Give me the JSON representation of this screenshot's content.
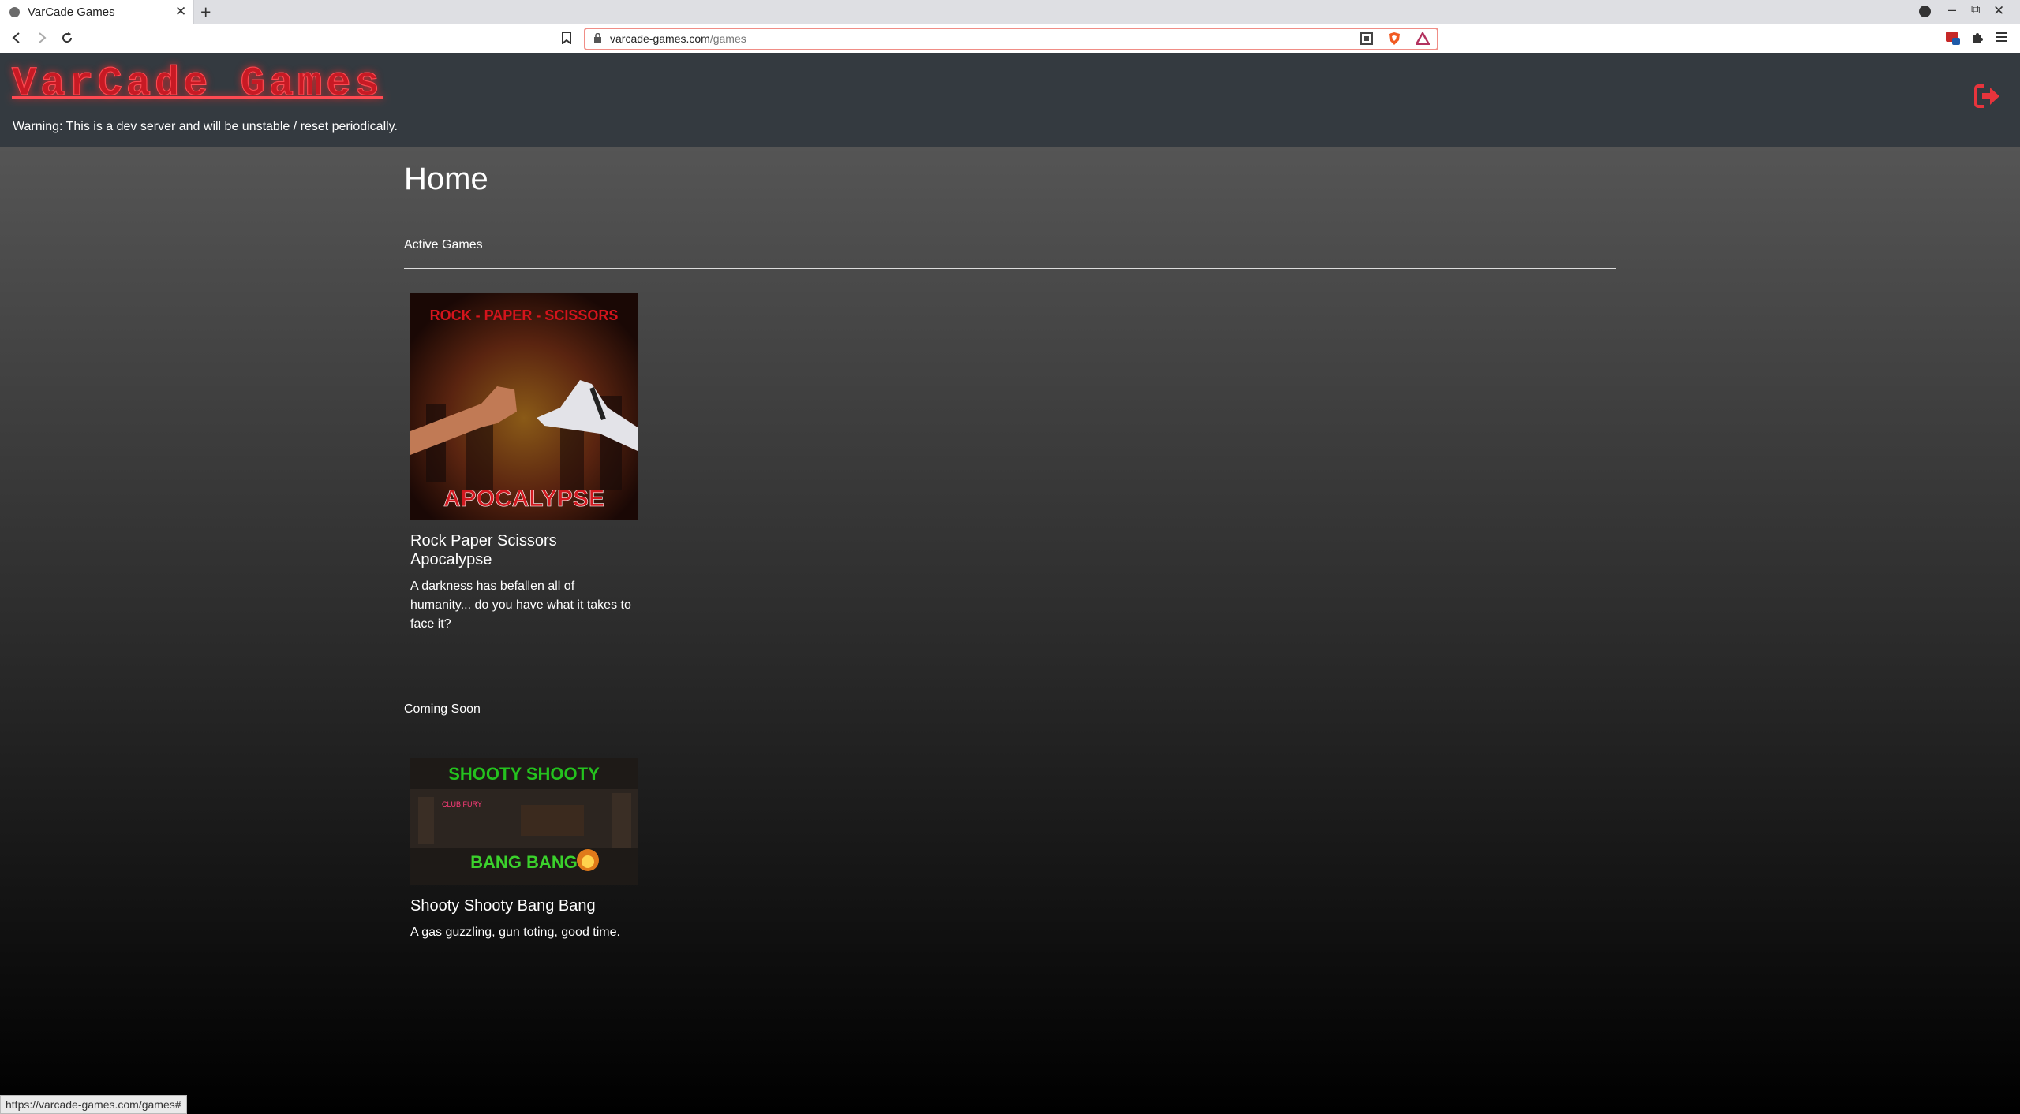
{
  "browser": {
    "tab_title": "VarCade Games",
    "tab_close": "✕",
    "new_tab": "+",
    "url_domain": "varcade-games.com",
    "url_path": "/games",
    "status_url": "https://varcade-games.com/games#",
    "window_controls": {
      "minimize": "–",
      "maximize": "⧉",
      "close": "✕"
    }
  },
  "header": {
    "logo": "VarCade Games",
    "warning": "Warning: This is a dev server and will be unstable / reset periodically."
  },
  "main": {
    "page_title": "Home",
    "active_section": {
      "title": "Active Games",
      "games": [
        {
          "name": "Rock Paper Scissors Apocalypse",
          "description": "A darkness has befallen all of humanity... do you have what it takes to face it?",
          "image_top_text": "ROCK - PAPER - SCISSORS",
          "image_bottom_text": "APOCALYPSE"
        }
      ]
    },
    "coming_section": {
      "title": "Coming Soon",
      "games": [
        {
          "name": "Shooty Shooty Bang Bang",
          "description": "A gas guzzling, gun toting, good time.",
          "image_top_text": "SHOOTY SHOOTY",
          "image_sign_text": "CLUB FURY",
          "image_bottom_text": "BANG BANG"
        }
      ]
    }
  },
  "colors": {
    "accent": "#e8343c",
    "header_bg": "#343a40"
  }
}
